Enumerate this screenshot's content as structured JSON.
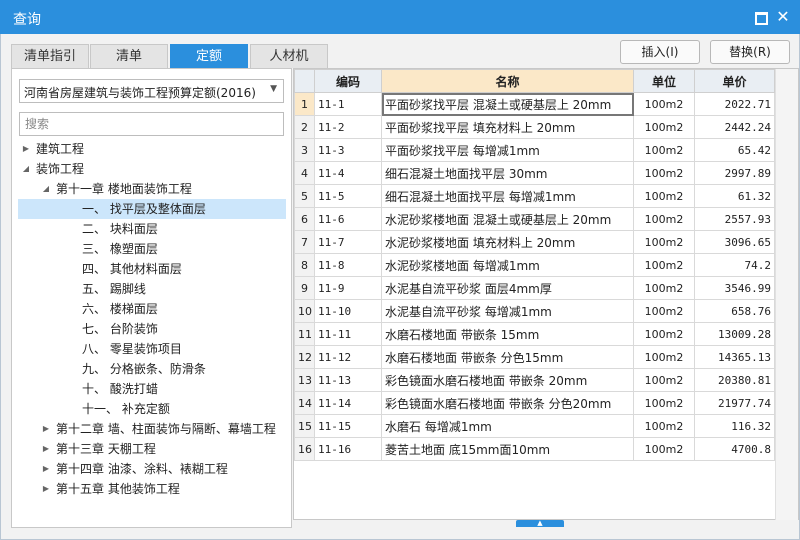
{
  "window": {
    "title": "查询"
  },
  "tabs": [
    {
      "label": "清单指引"
    },
    {
      "label": "清单"
    },
    {
      "label": "定额"
    },
    {
      "label": "人材机"
    }
  ],
  "toolbar": {
    "insert_label": "插入(I)",
    "replace_label": "替换(R)"
  },
  "left": {
    "selected_book": "河南省房屋建筑与装饰工程预算定额(2016)",
    "search_placeholder": "搜索"
  },
  "tree": [
    {
      "label": "建筑工程",
      "level": 1,
      "toggle": "▶"
    },
    {
      "label": "装饰工程",
      "level": 1,
      "toggle": "◢"
    },
    {
      "label": "第十一章 楼地面装饰工程",
      "level": 2,
      "toggle": "◢"
    },
    {
      "label": "一、 找平层及整体面层",
      "level": 3,
      "toggle": "",
      "selected": true
    },
    {
      "label": "二、 块料面层",
      "level": 3,
      "toggle": ""
    },
    {
      "label": "三、 橡塑面层",
      "level": 3,
      "toggle": ""
    },
    {
      "label": "四、 其他材料面层",
      "level": 3,
      "toggle": ""
    },
    {
      "label": "五、 踢脚线",
      "level": 3,
      "toggle": ""
    },
    {
      "label": "六、 楼梯面层",
      "level": 3,
      "toggle": ""
    },
    {
      "label": "七、 台阶装饰",
      "level": 3,
      "toggle": ""
    },
    {
      "label": "八、 零星装饰项目",
      "level": 3,
      "toggle": ""
    },
    {
      "label": "九、 分格嵌条、防滑条",
      "level": 3,
      "toggle": ""
    },
    {
      "label": "十、 酸洗打蜡",
      "level": 3,
      "toggle": ""
    },
    {
      "label": "十一、 补充定额",
      "level": 3,
      "toggle": ""
    },
    {
      "label": "第十二章 墙、柱面装饰与隔断、幕墙工程",
      "level": 2,
      "toggle": "▶"
    },
    {
      "label": "第十三章 天棚工程",
      "level": 2,
      "toggle": "▶"
    },
    {
      "label": "第十四章 油漆、涂料、裱糊工程",
      "level": 2,
      "toggle": "▶"
    },
    {
      "label": "第十五章 其他装饰工程",
      "level": 2,
      "toggle": "▶"
    }
  ],
  "table": {
    "columns": {
      "code": "编码",
      "name": "名称",
      "unit": "单位",
      "price": "单价"
    },
    "rows": [
      {
        "no": "1",
        "code": "11-1",
        "name": "平面砂浆找平层 混凝土或硬基层上 20mm",
        "unit": "100m2",
        "price": "2022.71"
      },
      {
        "no": "2",
        "code": "11-2",
        "name": "平面砂浆找平层 填充材料上 20mm",
        "unit": "100m2",
        "price": "2442.24"
      },
      {
        "no": "3",
        "code": "11-3",
        "name": "平面砂浆找平层 每增减1mm",
        "unit": "100m2",
        "price": "65.42"
      },
      {
        "no": "4",
        "code": "11-4",
        "name": "细石混凝土地面找平层 30mm",
        "unit": "100m2",
        "price": "2997.89"
      },
      {
        "no": "5",
        "code": "11-5",
        "name": "细石混凝土地面找平层 每增减1mm",
        "unit": "100m2",
        "price": "61.32"
      },
      {
        "no": "6",
        "code": "11-6",
        "name": "水泥砂浆楼地面 混凝土或硬基层上 20mm",
        "unit": "100m2",
        "price": "2557.93"
      },
      {
        "no": "7",
        "code": "11-7",
        "name": "水泥砂浆楼地面 填充材料上 20mm",
        "unit": "100m2",
        "price": "3096.65"
      },
      {
        "no": "8",
        "code": "11-8",
        "name": "水泥砂浆楼地面 每增减1mm",
        "unit": "100m2",
        "price": "74.2"
      },
      {
        "no": "9",
        "code": "11-9",
        "name": "水泥基自流平砂浆 面层4mm厚",
        "unit": "100m2",
        "price": "3546.99"
      },
      {
        "no": "10",
        "code": "11-10",
        "name": "水泥基自流平砂浆 每增减1mm",
        "unit": "100m2",
        "price": "658.76"
      },
      {
        "no": "11",
        "code": "11-11",
        "name": "水磨石楼地面 带嵌条 15mm",
        "unit": "100m2",
        "price": "13009.28"
      },
      {
        "no": "12",
        "code": "11-12",
        "name": "水磨石楼地面 带嵌条 分色15mm",
        "unit": "100m2",
        "price": "14365.13"
      },
      {
        "no": "13",
        "code": "11-13",
        "name": "彩色镜面水磨石楼地面 带嵌条 20mm",
        "unit": "100m2",
        "price": "20380.81"
      },
      {
        "no": "14",
        "code": "11-14",
        "name": "彩色镜面水磨石楼地面 带嵌条 分色20mm",
        "unit": "100m2",
        "price": "21977.74"
      },
      {
        "no": "15",
        "code": "11-15",
        "name": "水磨石 每增减1mm",
        "unit": "100m2",
        "price": "116.32"
      },
      {
        "no": "16",
        "code": "11-16",
        "name": "菱苦土地面 底15mm面10mm",
        "unit": "100m2",
        "price": "4700.8"
      }
    ]
  },
  "colors": {
    "accent": "#2b8fdd",
    "header_highlight": "#fbe8c8",
    "tree_selected": "#cce6fb"
  }
}
